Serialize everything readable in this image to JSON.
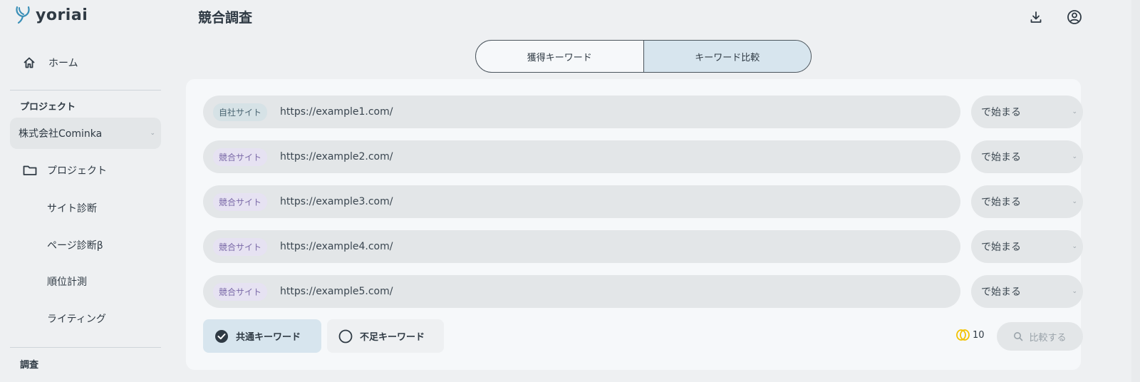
{
  "app": {
    "logo_text": "yoriai"
  },
  "sidebar": {
    "home_label": "ホーム",
    "project_section_label": "プロジェクト",
    "project_select_value": "株式会社Cominka",
    "items": [
      {
        "label": "プロジェクト",
        "icon": "folder-icon"
      },
      {
        "label": "サイト診断"
      },
      {
        "label": "ページ診断β"
      },
      {
        "label": "順位計測"
      },
      {
        "label": "ライティング"
      }
    ],
    "research_section_label": "調査"
  },
  "header": {
    "title": "競合調査",
    "download_icon": "download-icon",
    "account_icon": "account-icon"
  },
  "tabs": [
    {
      "label": "獲得キーワード",
      "active": false
    },
    {
      "label": "キーワード比較",
      "active": true
    }
  ],
  "sites": [
    {
      "badge": "自社サイト",
      "url": "https://example1.com/",
      "match": "で始まる"
    },
    {
      "badge": "競合サイト",
      "url": "https://example2.com/",
      "match": "で始まる"
    },
    {
      "badge": "競合サイト",
      "url": "https://example3.com/",
      "match": "で始まる"
    },
    {
      "badge": "競合サイト",
      "url": "https://example4.com/",
      "match": "で始まる"
    },
    {
      "badge": "競合サイト",
      "url": "https://example5.com/",
      "match": "で始まる"
    }
  ],
  "keyword_modes": {
    "common_label": "共通キーワード",
    "missing_label": "不足キーワード",
    "selected": "common"
  },
  "credits": {
    "value": "10"
  },
  "compare_button_label": "比較する",
  "colors": {
    "accent": "#2f3a44",
    "active_tab": "#d7e5ee",
    "coin": "#f2c200"
  }
}
